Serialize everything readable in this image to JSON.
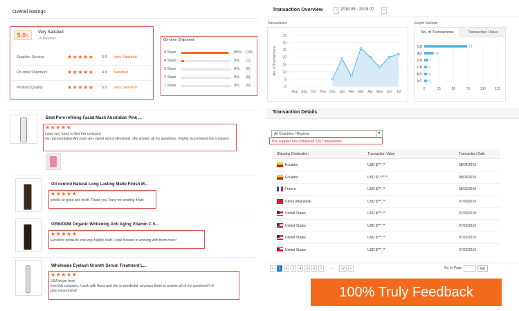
{
  "overall": {
    "title": "Overall Ratings",
    "score": "5.0",
    "score_unit": "/5",
    "summary": "Very Satisfied",
    "reviews": "19 Reviews",
    "rows": [
      {
        "label": "Supplier Service",
        "stars": "★★★★★",
        "score": "5.0",
        "verdict": "Very Satisfied"
      },
      {
        "label": "On-time Shipment",
        "stars": "★★★★★",
        "score": "4.9",
        "verdict": "Satisfied"
      },
      {
        "label": "Product Quality",
        "stars": "★★★★★",
        "score": "5.0",
        "verdict": "Very Satisfied"
      }
    ]
  },
  "shipment": {
    "title": "On-time Shipment",
    "rows": [
      {
        "label": "5 Stars",
        "pct": "95%",
        "count": "(18)",
        "fill": 0.95
      },
      {
        "label": "4 Stars",
        "pct": "5%",
        "count": "(1)",
        "fill": 0.05
      },
      {
        "label": "3 Stars",
        "pct": "0%",
        "count": "(0)",
        "fill": 0
      },
      {
        "label": "2 Stars",
        "pct": "0%",
        "count": "(0)",
        "fill": 0
      },
      {
        "label": "1 Stars",
        "pct": "0%",
        "count": "(0)",
        "fill": 0
      }
    ]
  },
  "reviews": [
    {
      "title": "Best Pore refining Facial Mask Australian Pink ...",
      "stars": "★★★★★",
      "text": "I was very lucky to find this company\nmy representative Ann was very sweet and professional. she answer all my questions.  i highly recommend this company"
    },
    {
      "title": "Oil control Natural Long Lasting Matte Finish M...",
      "stars": "★★★★★",
      "text": "smells so good and fresh. Thank you Tracy for sending it fast"
    },
    {
      "title": "OEM/ODM Organic Whitening Anti Aging Vitamin C S...",
      "stars": "★★★★★",
      "text": "Excellent products and very helpful staff, I look forward to working with them more!"
    },
    {
      "title": "Wholesale Eyelash Growth Serum Treatment L...",
      "stars": "★★★★★",
      "text": "USA buyer here.\nlove this company. I work with Anna and she is wonderful. anyways there to answer all of my questions!!! hi\nghly recommend!"
    }
  ],
  "txn_overview": {
    "title": "Transaction Overview",
    "date_range": "2018.08 - 2019.07",
    "prev": "‹",
    "next": "›",
    "chart_title": "Transactions",
    "export_title": "Export Markets",
    "tab_count": "No. of Transactions",
    "tab_value": "Transaction Value"
  },
  "chart_data": [
    {
      "type": "area",
      "title": "Transactions",
      "ylabel": "No. of Transactions",
      "categories": [
        "Aug",
        "Sep",
        "Oct",
        "Nov",
        "Dec",
        "Jan",
        "Feb",
        "Mar",
        "Apr",
        "May",
        "Jun",
        "Jul"
      ],
      "values": [
        null,
        null,
        null,
        null,
        5,
        19,
        7,
        26,
        20,
        13,
        20,
        22
      ],
      "ylim": [
        0,
        35
      ],
      "yticks": [
        0,
        5,
        10,
        15,
        20,
        25,
        30,
        35
      ],
      "grid": true
    },
    {
      "type": "bar",
      "title": "Export Markets",
      "categories": [
        "US",
        "AU",
        "CN",
        "UK",
        "MY",
        "KC"
      ],
      "values": [
        73,
        16,
        7,
        5,
        5,
        5
      ],
      "xlim": [
        0,
        125
      ],
      "xticks": [
        0,
        25,
        50,
        75,
        100,
        125
      ],
      "grid": true
    }
  ],
  "txn_details": {
    "title": "Transaction Details",
    "select_value": "All Countries / Regions",
    "select_arrow": "▼",
    "note": "This supplier has completed 136 Transactions.",
    "headers": [
      "Shipping Destination",
      "Transaction Value",
      "Transaction Date"
    ],
    "rows": [
      {
        "country": "Ecuador",
        "value": "USD $***.**",
        "date": "08/04/2019",
        "flag": "ec"
      },
      {
        "country": "Ecuador",
        "value": "USD $*,***.**",
        "date": "08/03/2019",
        "flag": "ec"
      },
      {
        "country": "France",
        "value": "USD $***.**",
        "date": "08/02/2019",
        "flag": "fr"
      },
      {
        "country": "China (Mainland)",
        "value": "USD $***.**",
        "date": "07/30/2019",
        "flag": "cn"
      },
      {
        "country": "United States",
        "value": "USD $***.**",
        "date": "07/30/2019",
        "flag": "us"
      },
      {
        "country": "United States",
        "value": "USD $***.**",
        "date": "07/25/2019",
        "flag": "us"
      },
      {
        "country": "United States",
        "value": "USD $***.**",
        "date": "07/22/2019",
        "flag": "us"
      },
      {
        "country": "United States",
        "value": "USD $***.**",
        "date": "07/22/2019",
        "flag": "us"
      }
    ],
    "pages": [
      "1",
      "2",
      "3",
      "4",
      "5",
      "6",
      "7",
      "...",
      "17"
    ],
    "first": "«",
    "next": "»",
    "goto_label": "Go to Page",
    "go_button": "Go"
  },
  "banner": {
    "text": "100% Truly Feedback",
    "color": "#f26b1d"
  },
  "colors": {
    "accent": "#f56a1e",
    "blue": "#4fb3e6",
    "red_box": "#d9534f"
  }
}
